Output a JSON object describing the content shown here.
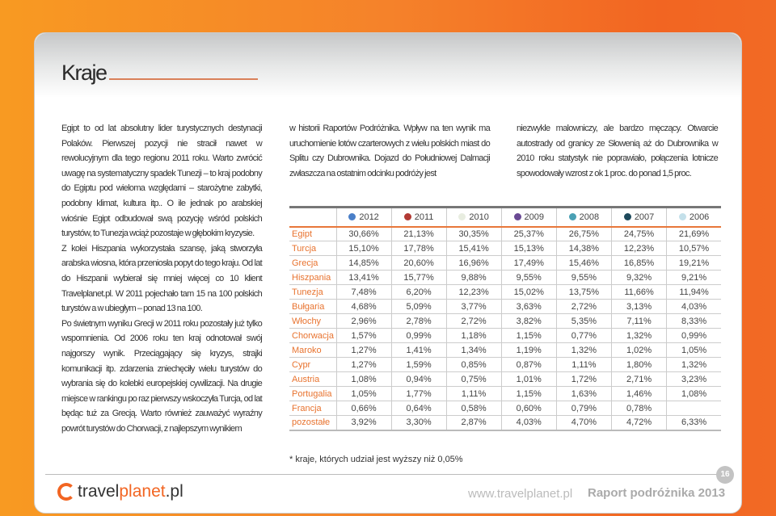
{
  "title": "Kraje",
  "col1": [
    "Egipt to od lat absolutny lider turystycznych destynacji Polaków. Pierwszej pozycji nie stracił nawet w rewolucyjnym dla tego regionu 2011 roku. Warto zwrócić uwagę na systematyczny spadek Tunezji – to kraj podobny do Egiptu pod wieloma względami – starożytne zabytki, podobny klimat, kultura itp.. O ile jednak po arabskiej wiośnie Egipt odbudował swą pozycję wśród polskich turystów, to Tunezja wciąż pozostaje w głębokim kryzysie.",
    "Z kolei Hiszpania wykorzystała szansę, jaką stworzyła arabska wiosna, która przeniosła popyt do tego kraju. Od lat do Hiszpanii wybierał się mniej więcej co 10 klient Travelplanet.pl. W 2011 pojechało tam 15 na 100 polskich turystów a w ubiegłym – ponad 13 na 100.",
    "Po świetnym wyniku Grecji w 2011 roku pozostały już tylko wspomnienia. Od 2006 roku ten kraj odnotował swój najgorszy wynik. Przeciągający się kryzys, strajki komunikacji itp. zdarzenia zniechęciły wielu turystów do wybrania się do kolebki europejskiej cywilizacji. Na drugie miejsce w rankingu po raz pierwszy wskoczyła Turcja, od lat będąc tuż za Grecją. Warto również zauważyć wyraźny powrót turystów do Chorwacji, z najlepszym wynikiem"
  ],
  "col2": "w historii Raportów Podróżnika. Wpływ na ten wynik ma uruchomienie lotów czarterowych z wielu polskich miast do Splitu czy Dubrownika. Dojazd do Południowej Dalmacji zwłaszcza na ostatnim odcinku podróży jest",
  "col3": "niezwykle malowniczy, ale bardzo męczący. Otwarcie autostrady od granicy ze Słowenią aż do Dubrownika w 2010 roku statystyk nie poprawiało, połączenia lotnicze spowodowały wzrost z ok 1 proc. do ponad 1,5 proc.",
  "table": {
    "years": [
      {
        "label": "2012",
        "color": "#4a7fc8"
      },
      {
        "label": "2011",
        "color": "#b23a34"
      },
      {
        "label": "2010",
        "color": "#e8ede0"
      },
      {
        "label": "2009",
        "color": "#6a4a94"
      },
      {
        "label": "2008",
        "color": "#4aa0b4"
      },
      {
        "label": "2007",
        "color": "#1e4a5c"
      },
      {
        "label": "2006",
        "color": "#c4e0ea"
      }
    ],
    "rows": [
      {
        "country": "Egipt",
        "values": [
          "30,66%",
          "21,13%",
          "30,35%",
          "25,37%",
          "26,75%",
          "24,75%",
          "21,69%"
        ]
      },
      {
        "country": "Turcja",
        "values": [
          "15,10%",
          "17,78%",
          "15,41%",
          "15,13%",
          "14,38%",
          "12,23%",
          "10,57%"
        ]
      },
      {
        "country": "Grecja",
        "values": [
          "14,85%",
          "20,60%",
          "16,96%",
          "17,49%",
          "15,46%",
          "16,85%",
          "19,21%"
        ]
      },
      {
        "country": "Hiszpania",
        "values": [
          "13,41%",
          "15,77%",
          "9,88%",
          "9,55%",
          "9,55%",
          "9,32%",
          "9,21%"
        ]
      },
      {
        "country": "Tunezja",
        "values": [
          "7,48%",
          "6,20%",
          "12,23%",
          "15,02%",
          "13,75%",
          "11,66%",
          "11,94%"
        ]
      },
      {
        "country": "Bułgaria",
        "values": [
          "4,68%",
          "5,09%",
          "3,77%",
          "3,63%",
          "2,72%",
          "3,13%",
          "4,03%"
        ]
      },
      {
        "country": "Włochy",
        "values": [
          "2,96%",
          "2,78%",
          "2,72%",
          "3,82%",
          "5,35%",
          "7,11%",
          "8,33%"
        ]
      },
      {
        "country": "Chorwacja",
        "values": [
          "1,57%",
          "0,99%",
          "1,18%",
          "1,15%",
          "0,77%",
          "1,32%",
          "0,99%"
        ]
      },
      {
        "country": "Maroko",
        "values": [
          "1,27%",
          "1,41%",
          "1,34%",
          "1,19%",
          "1,32%",
          "1,02%",
          "1,05%"
        ]
      },
      {
        "country": "Cypr",
        "values": [
          "1,27%",
          "1,59%",
          "0,85%",
          "0,87%",
          "1,11%",
          "1,80%",
          "1,32%"
        ]
      },
      {
        "country": "Austria",
        "values": [
          "1,08%",
          "0,94%",
          "0,75%",
          "1,01%",
          "1,72%",
          "2,71%",
          "3,23%"
        ]
      },
      {
        "country": "Portugalia",
        "values": [
          "1,05%",
          "1,77%",
          "1,11%",
          "1,15%",
          "1,63%",
          "1,46%",
          "1,08%"
        ]
      },
      {
        "country": "Francja",
        "values": [
          "0,66%",
          "0,64%",
          "0,58%",
          "0,60%",
          "0,79%",
          "0,78%",
          ""
        ]
      },
      {
        "country": "pozostałe",
        "values": [
          "3,92%",
          "3,30%",
          "2,87%",
          "4,03%",
          "4,70%",
          "4,72%",
          "6,33%"
        ]
      }
    ]
  },
  "footnote": "* kraje, których udział jest wyższy niż 0,05%",
  "footer": {
    "page": "16",
    "logo_a": "travel",
    "logo_b": "planet",
    "logo_c": ".pl",
    "url": "www.travelplanet.pl",
    "report": "Raport podróżnika 2013"
  }
}
